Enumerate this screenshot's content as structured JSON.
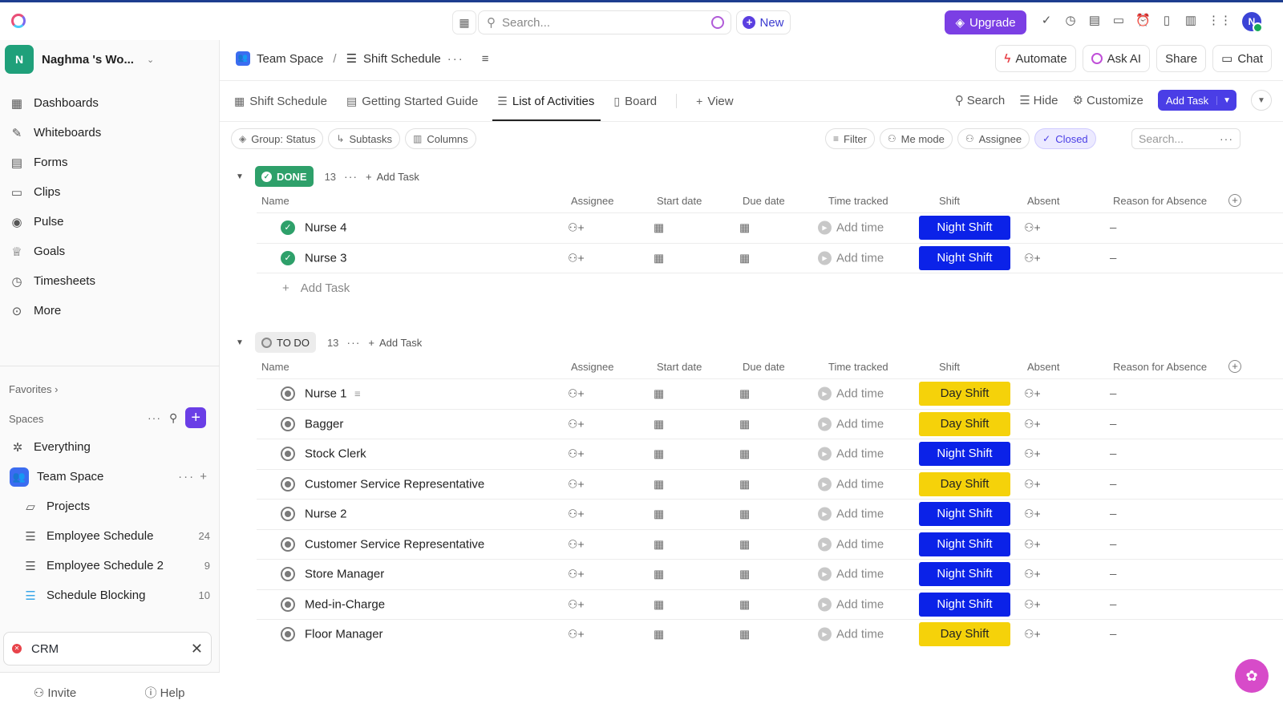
{
  "topbar": {
    "search_placeholder": "Search...",
    "new_label": "New",
    "upgrade_label": "Upgrade",
    "avatar_initial": "N"
  },
  "sidebar": {
    "workspace_initial": "N",
    "workspace_name": "Naghma 's Wo...",
    "nav": [
      {
        "label": "Dashboards",
        "icon": "dashboard-icon"
      },
      {
        "label": "Whiteboards",
        "icon": "whiteboard-icon"
      },
      {
        "label": "Forms",
        "icon": "forms-icon"
      },
      {
        "label": "Clips",
        "icon": "clips-icon"
      },
      {
        "label": "Pulse",
        "icon": "pulse-icon"
      },
      {
        "label": "Goals",
        "icon": "trophy-icon"
      },
      {
        "label": "Timesheets",
        "icon": "clock-icon"
      },
      {
        "label": "More",
        "icon": "more-icon"
      }
    ],
    "favorites_label": "Favorites",
    "spaces_label": "Spaces",
    "tree": {
      "everything": "Everything",
      "team_space": "Team Space",
      "projects": "Projects",
      "list1": "Employee Schedule",
      "list1_count": "24",
      "list2": "Employee Schedule 2",
      "list2_count": "9",
      "list3": "Schedule Blocking",
      "list3_count": "10"
    },
    "crm_label": "CRM",
    "invite_label": "Invite",
    "help_label": "Help"
  },
  "header": {
    "crumb_space": "Team Space",
    "crumb_sep": "/",
    "crumb_list": "Shift Schedule",
    "automate_label": "Automate",
    "ask_ai_label": "Ask AI",
    "share_label": "Share",
    "chat_label": "Chat"
  },
  "tabs": {
    "t1": "Shift Schedule",
    "t2": "Getting Started Guide",
    "t3": "List of Activities",
    "t4": "Board",
    "t5": "View",
    "search": "Search",
    "hide": "Hide",
    "customize": "Customize",
    "add_task": "Add Task"
  },
  "filters": {
    "group": "Group: Status",
    "subtasks": "Subtasks",
    "columns": "Columns",
    "filter": "Filter",
    "me_mode": "Me mode",
    "assignee": "Assignee",
    "closed": "Closed",
    "search_placeholder": "Search..."
  },
  "columns": {
    "name": "Name",
    "assignee": "Assignee",
    "start": "Start date",
    "due": "Due date",
    "time": "Time tracked",
    "shift": "Shift",
    "absent": "Absent",
    "reason": "Reason for Absence"
  },
  "common": {
    "add_time": "Add time",
    "dash": "–",
    "add_task": "Add Task"
  },
  "groups": {
    "done": {
      "label": "DONE",
      "count": "13",
      "rows": [
        {
          "name": "Nurse 4",
          "shift": "Night Shift"
        },
        {
          "name": "Nurse 3",
          "shift": "Night Shift"
        }
      ]
    },
    "todo": {
      "label": "TO DO",
      "count": "13",
      "rows": [
        {
          "name": "Nurse 1",
          "shift": "Day Shift"
        },
        {
          "name": "Bagger",
          "shift": "Day Shift"
        },
        {
          "name": "Stock Clerk",
          "shift": "Night Shift"
        },
        {
          "name": "Customer Service Representative",
          "shift": "Day Shift"
        },
        {
          "name": "Nurse 2",
          "shift": "Night Shift"
        },
        {
          "name": "Customer Service Representative",
          "shift": "Night Shift"
        },
        {
          "name": "Store Manager",
          "shift": "Night Shift"
        },
        {
          "name": "Med-in-Charge",
          "shift": "Night Shift"
        },
        {
          "name": "Floor Manager",
          "shift": "Day Shift"
        }
      ]
    }
  },
  "colors": {
    "night_shift": "#0b22e8",
    "day_shift": "#f5d20a",
    "done_badge": "#2ea06a",
    "accent": "#4a3ee6"
  }
}
